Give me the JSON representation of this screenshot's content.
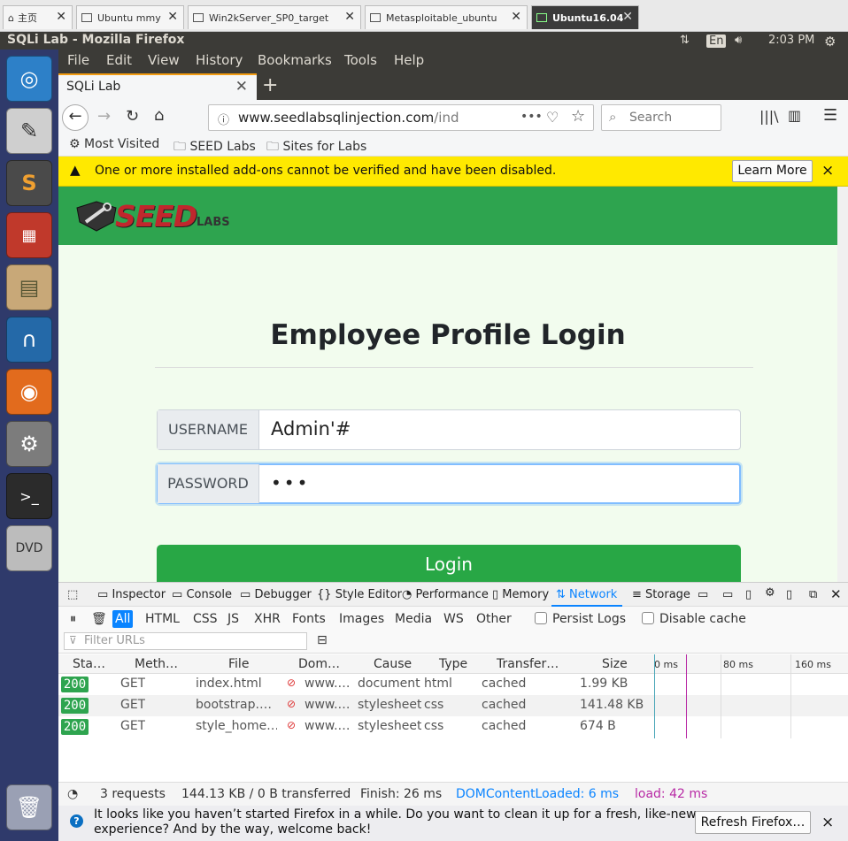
{
  "vm_tabs": [
    {
      "label": "主页",
      "active": false
    },
    {
      "label": "Ubuntu mmy",
      "active": false
    },
    {
      "label": "Win2kServer_SP0_target",
      "active": false
    },
    {
      "label": "Metasploitable_ubuntu",
      "active": false
    },
    {
      "label": "Ubuntu16.04",
      "active": true
    }
  ],
  "topbar": {
    "window_title": "SQLi Lab - Mozilla Firefox",
    "keyboard": "En",
    "time": "2:03 PM"
  },
  "launcher": {
    "items": [
      "ubuntu-dash-icon",
      "text-editor-icon",
      "sublime-text-icon",
      "terminal-split-icon",
      "file-manager-icon",
      "wireshark-icon",
      "firefox-icon",
      "system-settings-icon",
      "terminal-icon",
      "dvd-icon"
    ],
    "trash": "trash-icon"
  },
  "menu": [
    "File",
    "Edit",
    "View",
    "History",
    "Bookmarks",
    "Tools",
    "Help"
  ],
  "tab": {
    "title": "SQLi Lab",
    "new_tab": "+"
  },
  "nav": {
    "url_host": "www.seedlabsqlinjection.com",
    "url_path": "/index.htm",
    "search_placeholder": "Search",
    "more": "•••"
  },
  "bookmarks": [
    "Most Visited",
    "SEED Labs",
    "Sites for Labs"
  ],
  "notification": {
    "message": "One or more installed add-ons cannot be verified and have been disabled.",
    "button": "Learn More",
    "close": "×"
  },
  "page": {
    "logo_main": "SEED",
    "logo_sub": "LABS",
    "title": "Employee Profile Login",
    "username_label": "USERNAME",
    "username_value": "Admin'#",
    "password_label": "PASSWORD",
    "password_value": "•••",
    "login_button": "Login"
  },
  "devtools": {
    "tabs": [
      "Inspector",
      "Console",
      "Debugger",
      "Style Editor",
      "Performance",
      "Memory",
      "Network",
      "Storage"
    ],
    "selected_tab": "Network",
    "filters": [
      "All",
      "HTML",
      "CSS",
      "JS",
      "XHR",
      "Fonts",
      "Images",
      "Media",
      "WS",
      "Other"
    ],
    "persist_logs": "Persist Logs",
    "disable_cache": "Disable cache",
    "filter_placeholder": "Filter URLs",
    "columns": [
      "Sta…",
      "Meth…",
      "File",
      "Dom…",
      "Cause",
      "Type",
      "Transfer…",
      "Size"
    ],
    "timeline_ticks": [
      "0 ms",
      "80 ms",
      "160 ms"
    ],
    "rows": [
      {
        "status": "200",
        "method": "GET",
        "file": "index.html",
        "domain": "www.…",
        "cause": "document",
        "type": "html",
        "transferred": "cached",
        "size": "1.99 KB"
      },
      {
        "status": "200",
        "method": "GET",
        "file": "bootstrap.…",
        "domain": "www.…",
        "cause": "stylesheet",
        "type": "css",
        "transferred": "cached",
        "size": "141.48 KB"
      },
      {
        "status": "200",
        "method": "GET",
        "file": "style_home.…",
        "domain": "www.…",
        "cause": "stylesheet",
        "type": "css",
        "transferred": "cached",
        "size": "674 B"
      }
    ],
    "status": {
      "requests": "3 requests",
      "transferred": "144.13 KB / 0 B transferred",
      "finish": "Finish: 26 ms",
      "dom": "DOMContentLoaded: 6 ms",
      "load": "load: 42 ms"
    }
  },
  "refresh_notification": {
    "message_line1": "It looks like you haven’t started Firefox in a while. Do you want to clean it up for a fresh, like-new",
    "message_line2": "experience? And by the way, welcome back!",
    "button": "Refresh Firefox…",
    "close": "×"
  },
  "colors": {
    "seed_green": "#2ea44f",
    "login_green": "#28a745",
    "notif_yellow": "#ffe900",
    "network_blue": "#0a84ff",
    "launcher_bg": "#2f3a6b",
    "ubuntu_bar": "#3c3b37"
  }
}
